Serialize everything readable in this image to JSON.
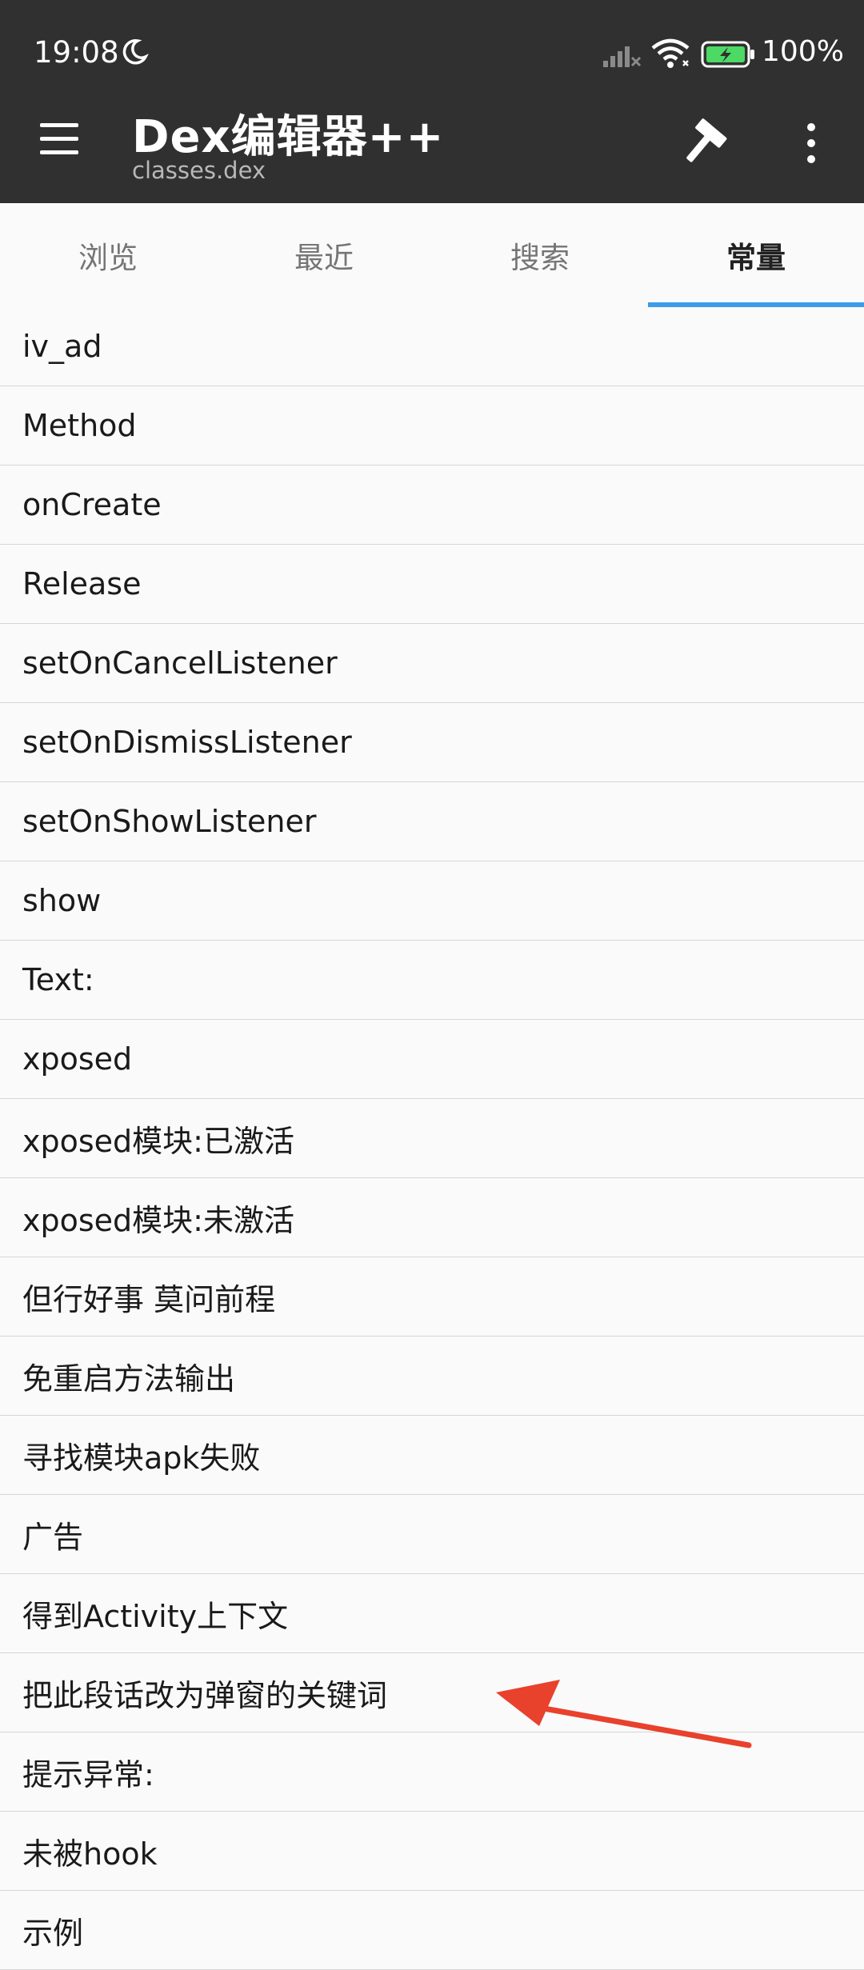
{
  "status_bar": {
    "time": "19:08",
    "battery": "100%"
  },
  "app_bar": {
    "title": "Dex编辑器++",
    "subtitle": "classes.dex"
  },
  "tabs": [
    {
      "label": "浏览"
    },
    {
      "label": "最近"
    },
    {
      "label": "搜索"
    },
    {
      "label": "常量"
    }
  ],
  "active_tab": "常量",
  "constants": [
    "iv_ad",
    "Method",
    "onCreate",
    "Release",
    "setOnCancelListener",
    "setOnDismissListener",
    "setOnShowListener",
    "show",
    "Text:",
    "xposed",
    "xposed模块:已激活",
    "xposed模块:未激活",
    "但行好事 莫问前程",
    "免重启方法输出",
    "寻找模块apk失败",
    "广告",
    "得到Activity上下文",
    "把此段话改为弹窗的关键词",
    "提示异常:",
    "未被hook",
    "示例"
  ],
  "colors": {
    "app_bar": "#303030",
    "accent": "#3d9bea",
    "arrow": "#e8412c"
  },
  "icons": [
    "moon-icon",
    "signal-icon",
    "wifi-icon",
    "battery-icon",
    "menu-icon",
    "hammer-icon",
    "overflow-menu-icon",
    "arrow-annotation"
  ]
}
